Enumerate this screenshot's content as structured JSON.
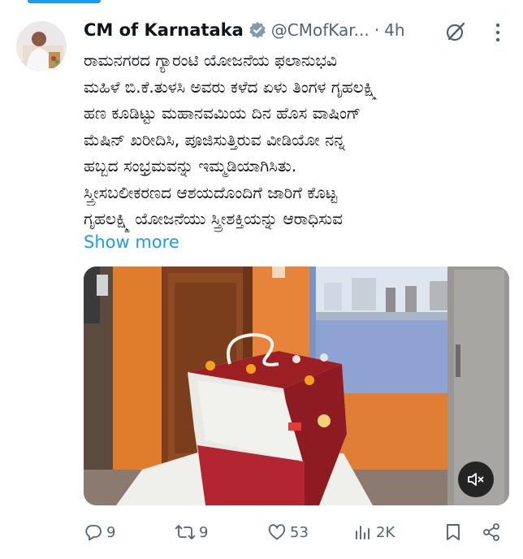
{
  "tweet": {
    "author_name": "CM of Karnataka",
    "handle": "@CMofKar...",
    "separator": "·",
    "time": "4h",
    "text_lines": [
      "ರಾಮನಗರದ ಗ್ಯಾರಂಟಿ ಯೋಜನೆಯ ಫಲಾನುಭವಿ",
      "ಮಹಿಳೆ ಬಿ.ಕೆ.ತುಳಸಿ ಅವರು ಕಳೆದ ಏಳು ತಿಂಗಳ ಗೃಹಲಕ್ಷ್ಮಿ",
      "ಹಣ ಕೂಡಿಟ್ಟು ಮಹಾನವಮಿಯ ದಿನ ಹೊಸ ವಾಷಿಂಗ್",
      "ಮೆಷಿನ್ ಖರೀದಿಸಿ, ಪೂಜಿಸುತ್ತಿರುವ ವೀಡಿಯೋ ನನ್ನ",
      "ಹಬ್ಬದ ಸಂಭ್ರಮವನ್ನು ಇಮ್ಮಡಿಯಾಗಿಸಿತು.",
      "ಸ್ತ್ರೀಸಬಲೀಕರಣದ ಆಶಯದೊಂದಿಗೆ ಜಾರಿಗೆ ಕೊಟ್ಟ",
      "ಗೃಹಲಕ್ಷ್ಮಿ ಯೋಜನೆಯು ಸ್ತ್ರೀಶಕ್ತಿಯನ್ನು ಆರಾಧಿಸುವ"
    ],
    "show_more": "Show more"
  },
  "actions": {
    "replies": "9",
    "reposts": "9",
    "likes": "53",
    "views": "2K"
  },
  "icons": {
    "verified": "verified-badge-icon",
    "grok": "grok-icon",
    "more": "more-vertical-icon",
    "mute": "volume-muted-icon",
    "reply": "reply-icon",
    "repost": "repost-icon",
    "like": "heart-icon",
    "views": "analytics-icon",
    "bookmark": "bookmark-icon",
    "share": "share-icon"
  },
  "colors": {
    "accent": "#1d9bf0",
    "text": "#0f1419",
    "secondary": "#536471"
  }
}
